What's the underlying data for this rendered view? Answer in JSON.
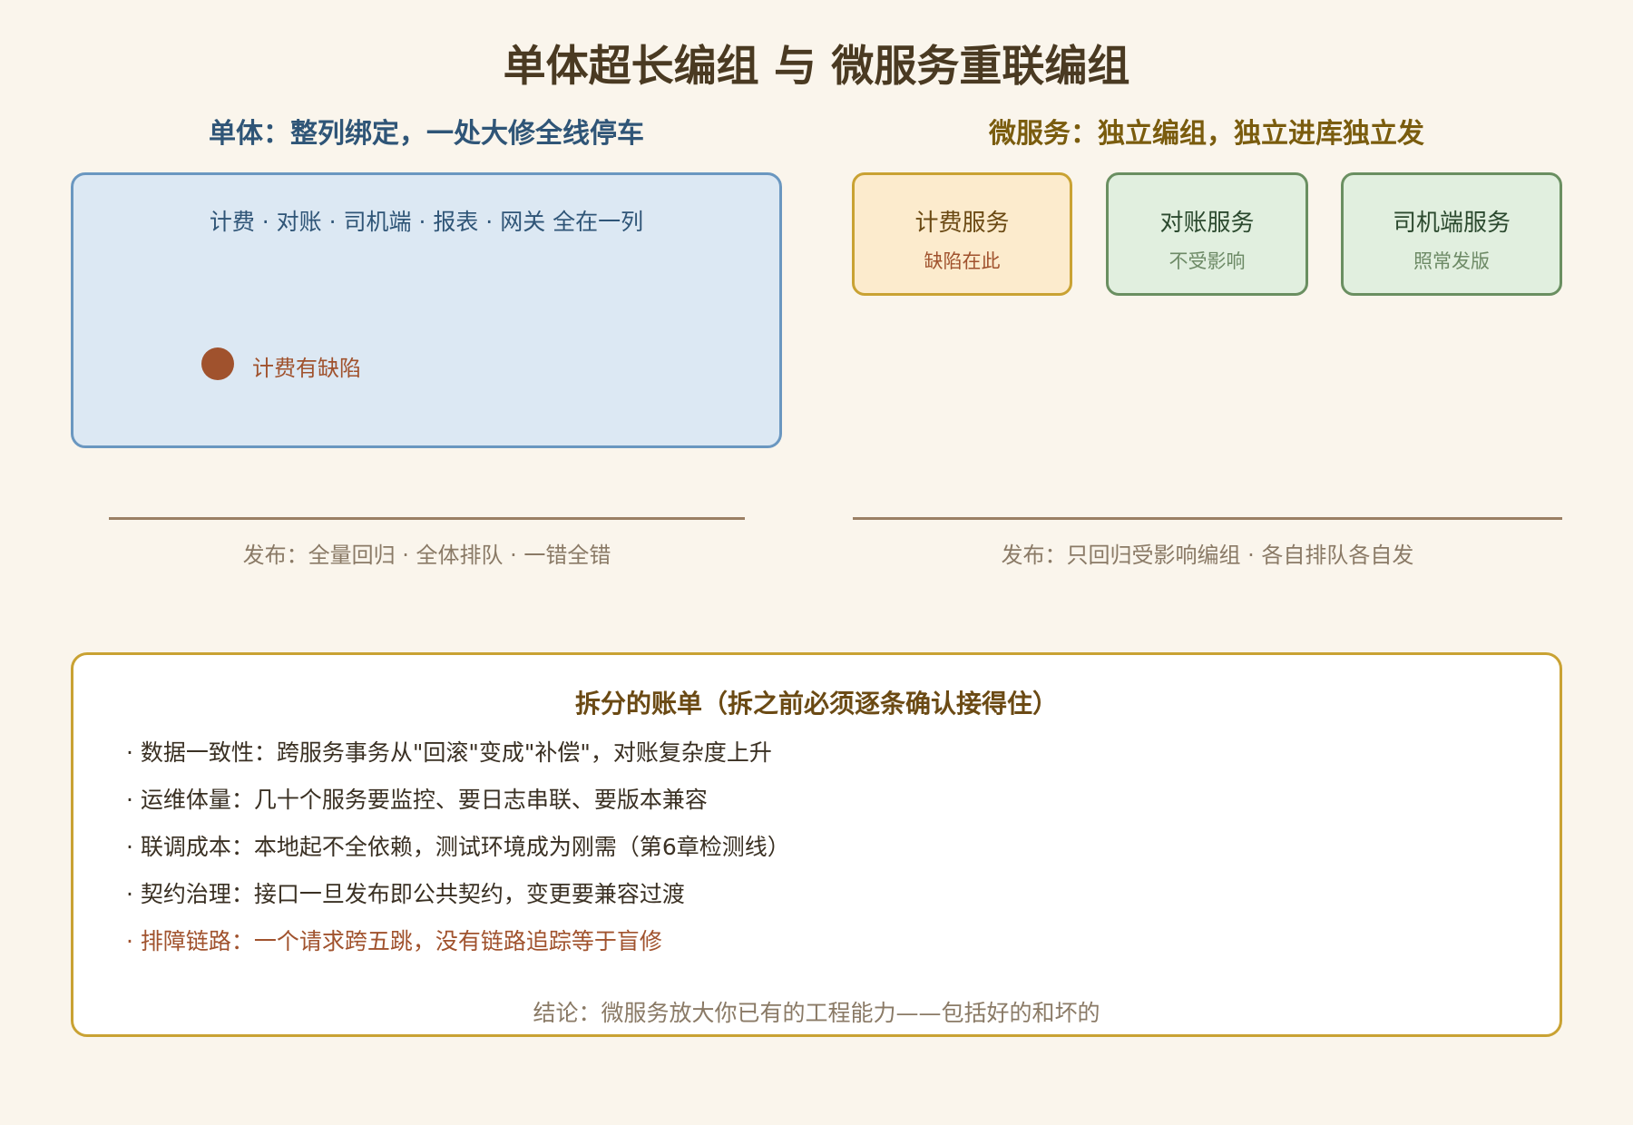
{
  "title": "单体超长编组 与 微服务重联编组",
  "monolith": {
    "heading": "单体：整列绑定，一处大修全线停车",
    "modules_text": "计费 · 对账 · 司机端 · 报表 · 网关 全在一列",
    "defect_label": "计费有缺陷",
    "release_text": "发布：全量回归 · 全体排队 · 一错全错"
  },
  "microservices": {
    "heading": "微服务：独立编组，独立进库独立发",
    "services": [
      {
        "name": "计费服务",
        "note": "缺陷在此"
      },
      {
        "name": "对账服务",
        "note": "不受影响"
      },
      {
        "name": "司机端服务",
        "note": "照常发版"
      }
    ],
    "release_text": "发布：只回归受影响编组 · 各自排队各自发"
  },
  "costs": {
    "title": "拆分的账单（拆之前必须逐条确认接得住）",
    "items": [
      "· 数据一致性：跨服务事务从\"回滚\"变成\"补偿\"，对账复杂度上升",
      "· 运维体量：几十个服务要监控、要日志串联、要版本兼容",
      "· 联调成本：本地起不全依赖，测试环境成为刚需（第6章检测线）",
      "· 契约治理：接口一旦发布即公共契约，变更要兼容过渡",
      "· 排障链路：一个请求跨五跳，没有链路追踪等于盲修"
    ],
    "conclusion": "结论：微服务放大你已有的工程能力——包括好的和坏的"
  },
  "colors": {
    "background": "#faf5ec",
    "monolith_fill": "#dce8f3",
    "monolith_border": "#6a97c0",
    "defect": "#a0522d",
    "service_ok_fill": "#e1efdf",
    "service_ok_border": "#6a8f61",
    "service_defect_fill": "#fcebcd",
    "accent_gold": "#c9a233"
  }
}
